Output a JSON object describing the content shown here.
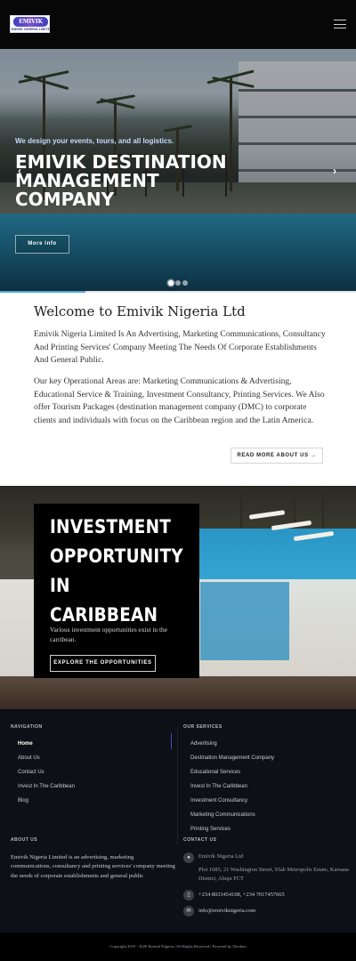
{
  "header": {
    "logo_mark_text": "EMIVIK",
    "logo_text": "EMIVIK NIGERIA LIMITED",
    "menu_icon": "hamburger-icon"
  },
  "hero": {
    "tagline": "We design your events, tours, and all logistics.",
    "title": "Emivik Destination Management Company",
    "button_label": "More Info",
    "prev_arrow": "‹",
    "next_arrow": "›",
    "slides_total": 3,
    "active_slide": 1,
    "progress_fraction": 0.24
  },
  "welcome": {
    "heading": "Welcome to Emivik Nigeria Ltd",
    "paragraph_1": "Emivik Nigeria Limited Is An Advertising, Marketing Communications, Consultancy And Printing Services' Company Meeting The Needs Of Corporate Establishments And General Public.",
    "paragraph_2": "Our key Operational Areas are: Marketing Communications & Advertising, Educational Service & Training,  Investment Consultancy,  Printing Services. We Also offer Tourism Packages (destination management company (DMC) to corporate clients and individuals with focus on the Caribbean region and the Latin America.",
    "read_more_label": "READ MORE ABOUT US",
    "read_more_icon": "→"
  },
  "investment": {
    "title_lines": [
      "INVESTMENT",
      "OPPORTUNITY",
      "IN CARIBBEAN"
    ],
    "description": "Various investment opportunities exist in the carribean.",
    "button_label": "EXPLORE THE OPPORTUNITIES"
  },
  "footer": {
    "navigation_heading": "NAVIGATION",
    "navigation": [
      "Home",
      "About Us",
      "Contact Us",
      "Invest In The Caribbean",
      "Blog"
    ],
    "active_nav": "Home",
    "services_heading": "OUR SERVICES",
    "services": [
      "Advertising",
      "Destination Management Company",
      "Educational Services",
      "Invest In The Caribbean",
      "Investment Consultancy",
      "Marketing Communications",
      "Printing Services"
    ],
    "about_heading": "ABOUT US",
    "about_text": "Emivik Nigeria Limited is an advertising, marketing communications, consultancy and printing services' company meeting the needs of corporate establishments and general public",
    "contact_heading": "CONTACT US",
    "contact": {
      "company": "Emivik Nigeria Ltd",
      "address": "Plot 1685, 21 Washington Street, Efab Metropolis Estate, Karsana District, Abuja FCT",
      "phone": "+234 8033454108, +234 7017457665",
      "email": "info@emiviknigeria.com",
      "location_icon": "location-pin-icon",
      "phone_icon": "phone-icon",
      "email_icon": "email-icon"
    },
    "copyright": "Copyright 2019 - 2020 Emivik Nigeria | All Rights Reserved | Powered by Devdata"
  },
  "colors": {
    "header_bg": "#070707",
    "accent": "#5aa9dd",
    "footer_bg": "#0d1016",
    "active_divider": "#3b4cc0"
  }
}
